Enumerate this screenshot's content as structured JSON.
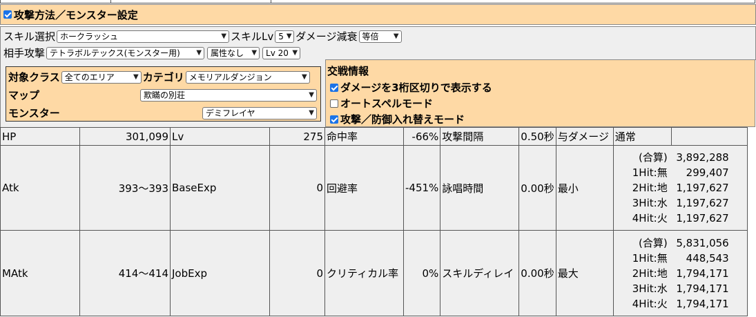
{
  "header": {
    "title": "攻撃方法／モンスター設定",
    "checked": true
  },
  "settings": {
    "skill_label": "スキル選択",
    "skill_value": "ホークラッシュ",
    "skill_lv_label": "スキルLv",
    "skill_lv_value": "5",
    "damage_decay_label": "ダメージ減衰",
    "damage_decay_value": "等倍",
    "enemy_attack_label": "相手攻撃",
    "enemy_attack_value": "テトラボルテックス(モンスター用)",
    "element_value": "属性なし",
    "enemy_lv_value": "Lv 20"
  },
  "target": {
    "class_label": "対象クラス",
    "class_value": "全てのエリア",
    "category_label": "カテゴリ",
    "category_value": "メモリアルダンジョン",
    "map_label": "マップ",
    "map_value": "欺瞞の別荘",
    "monster_label": "モンスター",
    "monster_value": "デミフレイヤ"
  },
  "battle": {
    "title": "交戦情報",
    "opt1": "ダメージを3桁区切りで表示する",
    "opt1_checked": true,
    "opt2": "オートスペルモード",
    "opt2_checked": false,
    "opt3": "攻撃／防御入れ替えモード",
    "opt3_checked": true
  },
  "stats": {
    "hp_label": "HP",
    "hp_value": "301,099",
    "lv_label": "Lv",
    "lv_value": "275",
    "hit_label": "命中率",
    "hit_value": "-66%",
    "interval_label": "攻撃間隔",
    "interval_value": "0.50秒",
    "dealt_label": "与ダメージ",
    "dealt_value": "通常",
    "atk_label": "Atk",
    "atk_value": "393～393",
    "baseexp_label": "BaseExp",
    "baseexp_value": "0",
    "flee_label": "回避率",
    "flee_value": "-451%",
    "cast_label": "詠唱時間",
    "cast_value": "0.00秒",
    "min_label": "最小",
    "matk_label": "MAtk",
    "matk_value": "414～414",
    "jobexp_label": "JobExp",
    "jobexp_value": "0",
    "crit_label": "クリティカル率",
    "crit_value": "0%",
    "delay_label": "スキルディレイ",
    "delay_value": "0.00秒",
    "max_label": "最大"
  },
  "damage_min": [
    {
      "k": "(合算)",
      "v": "3,892,288"
    },
    {
      "k": "1Hit:無",
      "v": "299,407"
    },
    {
      "k": "2Hit:地",
      "v": "1,197,627"
    },
    {
      "k": "3Hit:水",
      "v": "1,197,627"
    },
    {
      "k": "4Hit:火",
      "v": "1,197,627"
    }
  ],
  "damage_max": [
    {
      "k": "(合算)",
      "v": "5,831,056"
    },
    {
      "k": "1Hit:無",
      "v": "448,543"
    },
    {
      "k": "2Hit:地",
      "v": "1,794,171"
    },
    {
      "k": "3Hit:水",
      "v": "1,794,171"
    },
    {
      "k": "4Hit:火",
      "v": "1,794,171"
    }
  ]
}
